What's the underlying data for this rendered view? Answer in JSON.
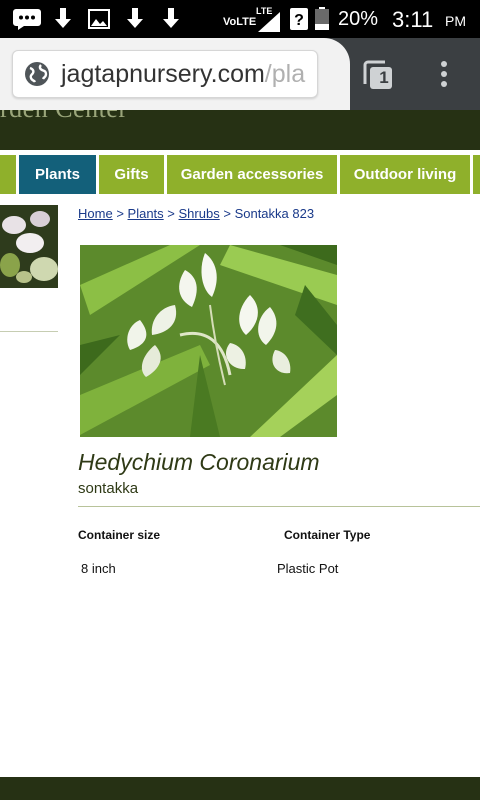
{
  "status_bar": {
    "network": "VoLTE",
    "lte": "LTE",
    "battery": "20%",
    "time": "3:11",
    "ampm": "PM",
    "icons": [
      "message-icon",
      "download-icon",
      "image-icon",
      "download-icon",
      "download-icon",
      "signal-icon",
      "battery-icon"
    ]
  },
  "browser": {
    "url_main": "jagtapnursery.com",
    "url_rest": "/pla",
    "tab_count": "1"
  },
  "header": {
    "logo_fragment": "rden Center"
  },
  "nav": {
    "items": [
      {
        "label": ""
      },
      {
        "label": "Plants"
      },
      {
        "label": "Gifts"
      },
      {
        "label": "Garden accessories"
      },
      {
        "label": "Outdoor living"
      },
      {
        "label": ""
      }
    ]
  },
  "breadcrumb": {
    "home": "Home",
    "plants": "Plants",
    "shrubs": "Shrubs",
    "sep": ">",
    "current": "Sontakka 823"
  },
  "product": {
    "name": "Hedychium Coronarium",
    "common_name": "sontakka",
    "specs": {
      "size_label": "Container size",
      "type_label": "Container Type",
      "size_value": "8 inch",
      "type_value": "Plastic Pot"
    }
  },
  "colors": {
    "nav_green": "#8fb02b",
    "nav_active": "#13607a",
    "header_dark": "#263114",
    "link_blue": "#1a3a8a"
  }
}
